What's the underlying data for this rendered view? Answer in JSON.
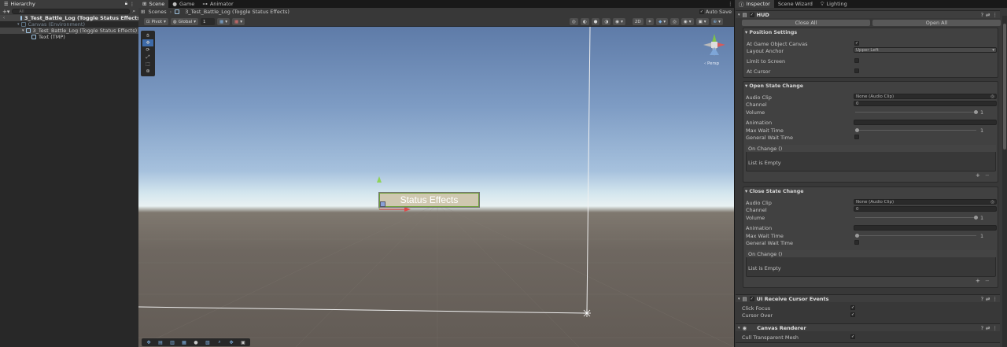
{
  "tabs": {
    "hierarchy": "Hierarchy",
    "scene": "Scene",
    "game": "Game",
    "animator": "Animator",
    "inspector": "Inspector",
    "scene_wizard": "Scene Wizard",
    "lighting": "Lighting"
  },
  "hierarchy": {
    "search_placeholder": "All",
    "items": [
      {
        "label": "3_Test_Battle_Log (Toggle Status Effects)"
      },
      {
        "label": "Canvas (Environment)"
      },
      {
        "label": "3_Test_Battle_Log (Toggle Status Effects)"
      },
      {
        "label": "Text (TMP)"
      }
    ]
  },
  "scene_header": {
    "scenes": "Scenes",
    "path": "3_Test_Battle_Log (Toggle Status Effects)",
    "auto_save": "Auto Save"
  },
  "scene_toolbar": {
    "pivot": "Pivot",
    "global": "Global",
    "grid_snap": "1",
    "mode_2d": "2D"
  },
  "viewport": {
    "button_text": "Status Effects",
    "persp": "‹ Persp"
  },
  "inspector": {
    "object_name": "HUD",
    "close_all": "Close All",
    "open_all": "Open All",
    "position_settings": {
      "header": "Position Settings",
      "at_game_object_canvas": "At Game Object Canvas",
      "layout_anchor": "Layout Anchor",
      "layout_anchor_value": "Upper Left",
      "limit_to_screen": "Limit to Screen",
      "at_cursor": "At Cursor"
    },
    "open_state": {
      "header": "Open State Change",
      "audio_clip": "Audio Clip",
      "audio_clip_value": "None (Audio Clip)",
      "channel": "Channel",
      "channel_value": "0",
      "volume": "Volume",
      "volume_value": "1",
      "animation": "Animation",
      "max_wait_time": "Max Wait Time",
      "max_wait_value": "1",
      "general_wait_time": "General Wait Time",
      "on_change": "On Change ()",
      "list_empty": "List is Empty"
    },
    "close_state": {
      "header": "Close State Change",
      "audio_clip": "Audio Clip",
      "audio_clip_value": "None (Audio Clip)",
      "channel": "Channel",
      "channel_value": "0",
      "volume": "Volume",
      "volume_value": "1",
      "animation": "Animation",
      "max_wait_time": "Max Wait Time",
      "max_wait_value": "1",
      "general_wait_time": "General Wait Time",
      "on_change": "On Change ()",
      "list_empty": "List is Empty"
    },
    "ui_receive": {
      "header": "UI Receive Cursor Events",
      "click_focus": "Click Focus",
      "cursor_over": "Cursor Over"
    },
    "canvas_renderer": {
      "header": "Canvas Renderer",
      "cull": "Cull Transparent Mesh"
    }
  }
}
